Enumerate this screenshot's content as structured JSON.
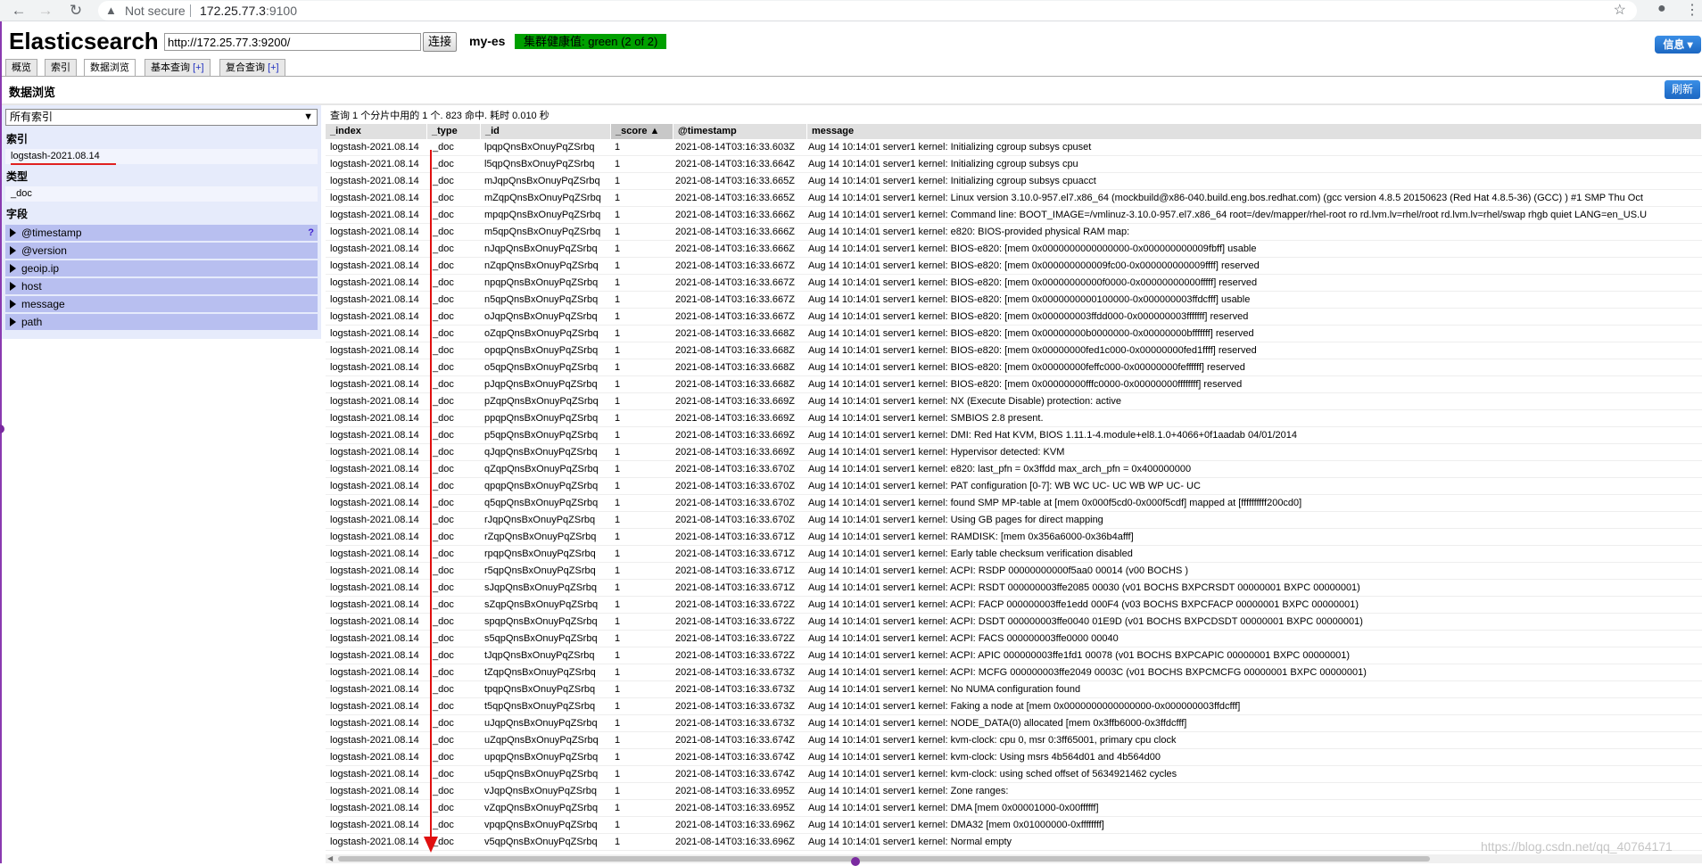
{
  "browser": {
    "security_label": "Not secure",
    "url_host": "172.25.77.3",
    "url_port": ":9100"
  },
  "app": {
    "title": "Elasticsearch",
    "connect_url": "http://172.25.77.3:9200/",
    "connect_label": "连接",
    "cluster_name": "my-es",
    "health_text": "集群健康值: green (2 of 2)",
    "health_color": "#00a000",
    "info_label": "信息",
    "accent_color": "#1c67c2"
  },
  "tabs": [
    {
      "label": "概览"
    },
    {
      "label": "索引"
    },
    {
      "label": "数据浏览"
    },
    {
      "label": "基本查询",
      "plus": "[+]"
    },
    {
      "label": "复合查询",
      "plus": "[+]"
    }
  ],
  "browser_section": {
    "title": "数据浏览",
    "refresh_label": "刷新",
    "index_select_value": "所有索引",
    "indices_heading": "索引",
    "index_item": "logstash-2021.08.14",
    "types_heading": "类型",
    "type_item": "_doc",
    "fields_heading": "字段",
    "fields": [
      "@timestamp",
      "@version",
      "geoip.ip",
      "host",
      "message",
      "path"
    ],
    "help_mark": "?"
  },
  "results": {
    "summary": "查询 1 个分片中用的 1 个. 823 命中. 耗时 0.010 秒",
    "columns": [
      "_index",
      "_type",
      "_id",
      "_score ▲",
      "@timestamp",
      "message"
    ],
    "rows": [
      [
        "logstash-2021.08.14",
        "_doc",
        "lpqpQnsBxOnuyPqZSrbq",
        "1",
        "2021-08-14T03:16:33.603Z",
        "Aug 14 10:14:01 server1 kernel: Initializing cgroup subsys cpuset"
      ],
      [
        "logstash-2021.08.14",
        "_doc",
        "l5qpQnsBxOnuyPqZSrbq",
        "1",
        "2021-08-14T03:16:33.664Z",
        "Aug 14 10:14:01 server1 kernel: Initializing cgroup subsys cpu"
      ],
      [
        "logstash-2021.08.14",
        "_doc",
        "mJqpQnsBxOnuyPqZSrbq",
        "1",
        "2021-08-14T03:16:33.665Z",
        "Aug 14 10:14:01 server1 kernel: Initializing cgroup subsys cpuacct"
      ],
      [
        "logstash-2021.08.14",
        "_doc",
        "mZqpQnsBxOnuyPqZSrbq",
        "1",
        "2021-08-14T03:16:33.665Z",
        "Aug 14 10:14:01 server1 kernel: Linux version 3.10.0-957.el7.x86_64 (mockbuild@x86-040.build.eng.bos.redhat.com) (gcc version 4.8.5 20150623 (Red Hat 4.8.5-36) (GCC) ) #1 SMP Thu Oct"
      ],
      [
        "logstash-2021.08.14",
        "_doc",
        "mpqpQnsBxOnuyPqZSrbq",
        "1",
        "2021-08-14T03:16:33.666Z",
        "Aug 14 10:14:01 server1 kernel: Command line: BOOT_IMAGE=/vmlinuz-3.10.0-957.el7.x86_64 root=/dev/mapper/rhel-root ro rd.lvm.lv=rhel/root rd.lvm.lv=rhel/swap rhgb quiet LANG=en_US.U"
      ],
      [
        "logstash-2021.08.14",
        "_doc",
        "m5qpQnsBxOnuyPqZSrbq",
        "1",
        "2021-08-14T03:16:33.666Z",
        "Aug 14 10:14:01 server1 kernel: e820: BIOS-provided physical RAM map:"
      ],
      [
        "logstash-2021.08.14",
        "_doc",
        "nJqpQnsBxOnuyPqZSrbq",
        "1",
        "2021-08-14T03:16:33.666Z",
        "Aug 14 10:14:01 server1 kernel: BIOS-e820: [mem 0x0000000000000000-0x000000000009fbff] usable"
      ],
      [
        "logstash-2021.08.14",
        "_doc",
        "nZqpQnsBxOnuyPqZSrbq",
        "1",
        "2021-08-14T03:16:33.667Z",
        "Aug 14 10:14:01 server1 kernel: BIOS-e820: [mem 0x000000000009fc00-0x000000000009ffff] reserved"
      ],
      [
        "logstash-2021.08.14",
        "_doc",
        "npqpQnsBxOnuyPqZSrbq",
        "1",
        "2021-08-14T03:16:33.667Z",
        "Aug 14 10:14:01 server1 kernel: BIOS-e820: [mem 0x00000000000f0000-0x00000000000fffff] reserved"
      ],
      [
        "logstash-2021.08.14",
        "_doc",
        "n5qpQnsBxOnuyPqZSrbq",
        "1",
        "2021-08-14T03:16:33.667Z",
        "Aug 14 10:14:01 server1 kernel: BIOS-e820: [mem 0x0000000000100000-0x000000003ffdcfff] usable"
      ],
      [
        "logstash-2021.08.14",
        "_doc",
        "oJqpQnsBxOnuyPqZSrbq",
        "1",
        "2021-08-14T03:16:33.667Z",
        "Aug 14 10:14:01 server1 kernel: BIOS-e820: [mem 0x000000003ffdd000-0x000000003fffffff] reserved"
      ],
      [
        "logstash-2021.08.14",
        "_doc",
        "oZqpQnsBxOnuyPqZSrbq",
        "1",
        "2021-08-14T03:16:33.668Z",
        "Aug 14 10:14:01 server1 kernel: BIOS-e820: [mem 0x00000000b0000000-0x00000000bfffffff] reserved"
      ],
      [
        "logstash-2021.08.14",
        "_doc",
        "opqpQnsBxOnuyPqZSrbq",
        "1",
        "2021-08-14T03:16:33.668Z",
        "Aug 14 10:14:01 server1 kernel: BIOS-e820: [mem 0x00000000fed1c000-0x00000000fed1ffff] reserved"
      ],
      [
        "logstash-2021.08.14",
        "_doc",
        "o5qpQnsBxOnuyPqZSrbq",
        "1",
        "2021-08-14T03:16:33.668Z",
        "Aug 14 10:14:01 server1 kernel: BIOS-e820: [mem 0x00000000feffc000-0x00000000feffffff] reserved"
      ],
      [
        "logstash-2021.08.14",
        "_doc",
        "pJqpQnsBxOnuyPqZSrbq",
        "1",
        "2021-08-14T03:16:33.668Z",
        "Aug 14 10:14:01 server1 kernel: BIOS-e820: [mem 0x00000000fffc0000-0x00000000ffffffff] reserved"
      ],
      [
        "logstash-2021.08.14",
        "_doc",
        "pZqpQnsBxOnuyPqZSrbq",
        "1",
        "2021-08-14T03:16:33.669Z",
        "Aug 14 10:14:01 server1 kernel: NX (Execute Disable) protection: active"
      ],
      [
        "logstash-2021.08.14",
        "_doc",
        "ppqpQnsBxOnuyPqZSrbq",
        "1",
        "2021-08-14T03:16:33.669Z",
        "Aug 14 10:14:01 server1 kernel: SMBIOS 2.8 present."
      ],
      [
        "logstash-2021.08.14",
        "_doc",
        "p5qpQnsBxOnuyPqZSrbq",
        "1",
        "2021-08-14T03:16:33.669Z",
        "Aug 14 10:14:01 server1 kernel: DMI: Red Hat KVM, BIOS 1.11.1-4.module+el8.1.0+4066+0f1aadab 04/01/2014"
      ],
      [
        "logstash-2021.08.14",
        "_doc",
        "qJqpQnsBxOnuyPqZSrbq",
        "1",
        "2021-08-14T03:16:33.669Z",
        "Aug 14 10:14:01 server1 kernel: Hypervisor detected: KVM"
      ],
      [
        "logstash-2021.08.14",
        "_doc",
        "qZqpQnsBxOnuyPqZSrbq",
        "1",
        "2021-08-14T03:16:33.670Z",
        "Aug 14 10:14:01 server1 kernel: e820: last_pfn = 0x3ffdd max_arch_pfn = 0x400000000"
      ],
      [
        "logstash-2021.08.14",
        "_doc",
        "qpqpQnsBxOnuyPqZSrbq",
        "1",
        "2021-08-14T03:16:33.670Z",
        "Aug 14 10:14:01 server1 kernel: PAT configuration [0-7]: WB WC UC- UC WB WP UC- UC"
      ],
      [
        "logstash-2021.08.14",
        "_doc",
        "q5qpQnsBxOnuyPqZSrbq",
        "1",
        "2021-08-14T03:16:33.670Z",
        "Aug 14 10:14:01 server1 kernel: found SMP MP-table at [mem 0x000f5cd0-0x000f5cdf] mapped at [ffffffffff200cd0]"
      ],
      [
        "logstash-2021.08.14",
        "_doc",
        "rJqpQnsBxOnuyPqZSrbq",
        "1",
        "2021-08-14T03:16:33.670Z",
        "Aug 14 10:14:01 server1 kernel: Using GB pages for direct mapping"
      ],
      [
        "logstash-2021.08.14",
        "_doc",
        "rZqpQnsBxOnuyPqZSrbq",
        "1",
        "2021-08-14T03:16:33.671Z",
        "Aug 14 10:14:01 server1 kernel: RAMDISK: [mem 0x356a6000-0x36b4afff]"
      ],
      [
        "logstash-2021.08.14",
        "_doc",
        "rpqpQnsBxOnuyPqZSrbq",
        "1",
        "2021-08-14T03:16:33.671Z",
        "Aug 14 10:14:01 server1 kernel: Early table checksum verification disabled"
      ],
      [
        "logstash-2021.08.14",
        "_doc",
        "r5qpQnsBxOnuyPqZSrbq",
        "1",
        "2021-08-14T03:16:33.671Z",
        "Aug 14 10:14:01 server1 kernel: ACPI: RSDP 00000000000f5aa0 00014 (v00 BOCHS )"
      ],
      [
        "logstash-2021.08.14",
        "_doc",
        "sJqpQnsBxOnuyPqZSrbq",
        "1",
        "2021-08-14T03:16:33.671Z",
        "Aug 14 10:14:01 server1 kernel: ACPI: RSDT 000000003ffe2085 00030 (v01 BOCHS BXPCRSDT 00000001 BXPC 00000001)"
      ],
      [
        "logstash-2021.08.14",
        "_doc",
        "sZqpQnsBxOnuyPqZSrbq",
        "1",
        "2021-08-14T03:16:33.672Z",
        "Aug 14 10:14:01 server1 kernel: ACPI: FACP 000000003ffe1edd 000F4 (v03 BOCHS BXPCFACP 00000001 BXPC 00000001)"
      ],
      [
        "logstash-2021.08.14",
        "_doc",
        "spqpQnsBxOnuyPqZSrbq",
        "1",
        "2021-08-14T03:16:33.672Z",
        "Aug 14 10:14:01 server1 kernel: ACPI: DSDT 000000003ffe0040 01E9D (v01 BOCHS BXPCDSDT 00000001 BXPC 00000001)"
      ],
      [
        "logstash-2021.08.14",
        "_doc",
        "s5qpQnsBxOnuyPqZSrbq",
        "1",
        "2021-08-14T03:16:33.672Z",
        "Aug 14 10:14:01 server1 kernel: ACPI: FACS 000000003ffe0000 00040"
      ],
      [
        "logstash-2021.08.14",
        "_doc",
        "tJqpQnsBxOnuyPqZSrbq",
        "1",
        "2021-08-14T03:16:33.672Z",
        "Aug 14 10:14:01 server1 kernel: ACPI: APIC 000000003ffe1fd1 00078 (v01 BOCHS BXPCAPIC 00000001 BXPC 00000001)"
      ],
      [
        "logstash-2021.08.14",
        "_doc",
        "tZqpQnsBxOnuyPqZSrbq",
        "1",
        "2021-08-14T03:16:33.673Z",
        "Aug 14 10:14:01 server1 kernel: ACPI: MCFG 000000003ffe2049 0003C (v01 BOCHS BXPCMCFG 00000001 BXPC 00000001)"
      ],
      [
        "logstash-2021.08.14",
        "_doc",
        "tpqpQnsBxOnuyPqZSrbq",
        "1",
        "2021-08-14T03:16:33.673Z",
        "Aug 14 10:14:01 server1 kernel: No NUMA configuration found"
      ],
      [
        "logstash-2021.08.14",
        "_doc",
        "t5qpQnsBxOnuyPqZSrbq",
        "1",
        "2021-08-14T03:16:33.673Z",
        "Aug 14 10:14:01 server1 kernel: Faking a node at [mem 0x0000000000000000-0x000000003ffdcfff]"
      ],
      [
        "logstash-2021.08.14",
        "_doc",
        "uJqpQnsBxOnuyPqZSrbq",
        "1",
        "2021-08-14T03:16:33.673Z",
        "Aug 14 10:14:01 server1 kernel: NODE_DATA(0) allocated [mem 0x3ffb6000-0x3ffdcfff]"
      ],
      [
        "logstash-2021.08.14",
        "_doc",
        "uZqpQnsBxOnuyPqZSrbq",
        "1",
        "2021-08-14T03:16:33.674Z",
        "Aug 14 10:14:01 server1 kernel: kvm-clock: cpu 0, msr 0:3ff65001, primary cpu clock"
      ],
      [
        "logstash-2021.08.14",
        "_doc",
        "upqpQnsBxOnuyPqZSrbq",
        "1",
        "2021-08-14T03:16:33.674Z",
        "Aug 14 10:14:01 server1 kernel: kvm-clock: Using msrs 4b564d01 and 4b564d00"
      ],
      [
        "logstash-2021.08.14",
        "_doc",
        "u5qpQnsBxOnuyPqZSrbq",
        "1",
        "2021-08-14T03:16:33.674Z",
        "Aug 14 10:14:01 server1 kernel: kvm-clock: using sched offset of 5634921462 cycles"
      ],
      [
        "logstash-2021.08.14",
        "_doc",
        "vJqpQnsBxOnuyPqZSrbq",
        "1",
        "2021-08-14T03:16:33.695Z",
        "Aug 14 10:14:01 server1 kernel: Zone ranges:"
      ],
      [
        "logstash-2021.08.14",
        "_doc",
        "vZqpQnsBxOnuyPqZSrbq",
        "1",
        "2021-08-14T03:16:33.695Z",
        "Aug 14 10:14:01 server1 kernel: DMA [mem 0x00001000-0x00ffffff]"
      ],
      [
        "logstash-2021.08.14",
        "_doc",
        "vpqpQnsBxOnuyPqZSrbq",
        "1",
        "2021-08-14T03:16:33.696Z",
        "Aug 14 10:14:01 server1 kernel: DMA32 [mem 0x01000000-0xffffffff]"
      ],
      [
        "logstash-2021.08.14",
        "_doc",
        "v5qpQnsBxOnuyPqZSrbq",
        "1",
        "2021-08-14T03:16:33.696Z",
        "Aug 14 10:14:01 server1 kernel: Normal empty"
      ]
    ]
  },
  "watermark": "https://blog.csdn.net/qq_40764171"
}
